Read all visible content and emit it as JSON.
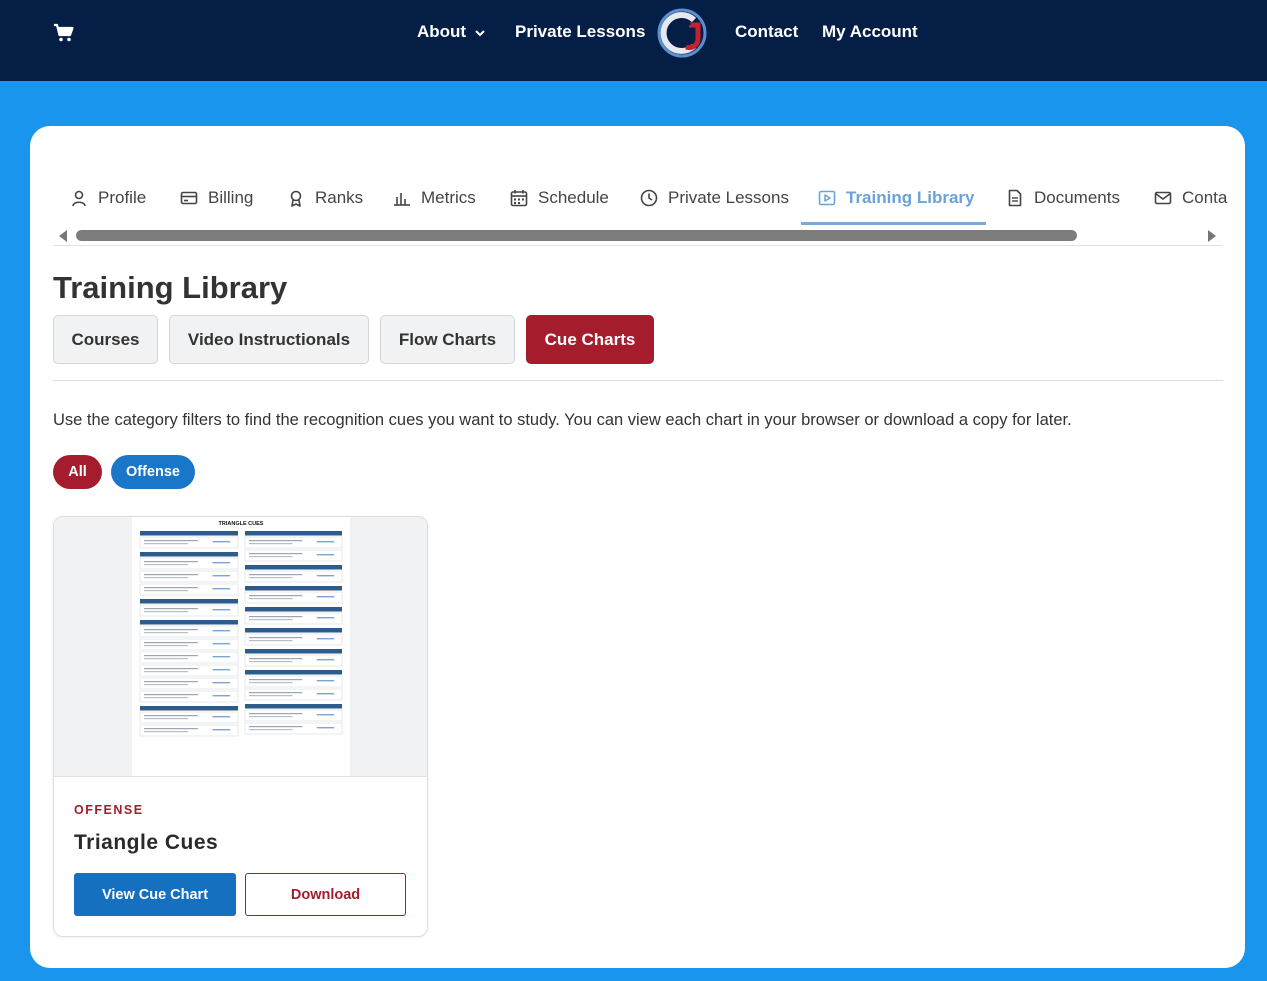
{
  "topnav": {
    "items": [
      {
        "label": "About"
      },
      {
        "label": "Private Lessons"
      },
      {
        "label": "Contact"
      },
      {
        "label": "My Account"
      }
    ]
  },
  "tabs": [
    {
      "label": "Profile",
      "icon": "person-icon"
    },
    {
      "label": "Billing",
      "icon": "card-icon"
    },
    {
      "label": "Ranks",
      "icon": "medal-icon"
    },
    {
      "label": "Metrics",
      "icon": "bar-chart-icon"
    },
    {
      "label": "Schedule",
      "icon": "calendar-icon"
    },
    {
      "label": "Private Lessons",
      "icon": "clock-icon"
    },
    {
      "label": "Training Library",
      "icon": "play-icon",
      "active": true
    },
    {
      "label": "Documents",
      "icon": "document-icon"
    },
    {
      "label": "Conta",
      "icon": "mail-icon"
    }
  ],
  "page": {
    "title": "Training Library",
    "subtabs": [
      {
        "label": "Courses"
      },
      {
        "label": "Video Instructionals"
      },
      {
        "label": "Flow Charts"
      },
      {
        "label": "Cue Charts",
        "active": true
      }
    ],
    "intro": "Use the category filters to find the recognition cues you want to study. You can view each chart in your browser or download a copy for later.",
    "filters": [
      {
        "label": "All",
        "active": true
      },
      {
        "label": "Offense"
      }
    ]
  },
  "cards": [
    {
      "category": "OFFENSE",
      "title": "Triangle Cues",
      "thumbnail_title": "TRIANGLE CUES",
      "view_label": "View Cue Chart",
      "download_label": "Download"
    }
  ],
  "colors": {
    "nav_bg": "#041e46",
    "page_bg": "#1a95ee",
    "accent_red": "#a51c2c",
    "accent_blue": "#1570bf",
    "tab_active": "#6aa2d9"
  }
}
